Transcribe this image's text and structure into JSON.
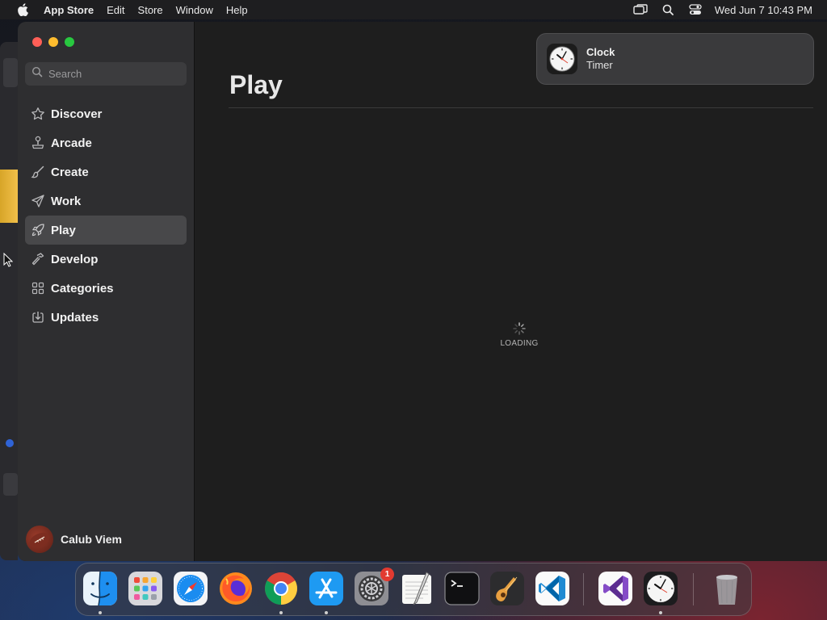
{
  "menubar": {
    "apple_icon": "apple-logo-icon",
    "app_name": "App Store",
    "menus": [
      "Edit",
      "Store",
      "Window",
      "Help"
    ],
    "status_icons": [
      "screen-mirroring-icon",
      "spotlight-search-icon",
      "control-center-icon"
    ],
    "datetime": "Wed Jun 7  10:43 PM"
  },
  "window": {
    "search": {
      "placeholder": "Search",
      "value": ""
    },
    "sidebar": {
      "items": [
        {
          "label": "Discover",
          "icon": "star-icon",
          "selected": false
        },
        {
          "label": "Arcade",
          "icon": "joystick-icon",
          "selected": false
        },
        {
          "label": "Create",
          "icon": "paintbrush-icon",
          "selected": false
        },
        {
          "label": "Work",
          "icon": "paperplane-icon",
          "selected": false
        },
        {
          "label": "Play",
          "icon": "rocket-icon",
          "selected": true
        },
        {
          "label": "Develop",
          "icon": "hammer-icon",
          "selected": false
        },
        {
          "label": "Categories",
          "icon": "grid-icon",
          "selected": false
        },
        {
          "label": "Updates",
          "icon": "download-icon",
          "selected": false
        }
      ],
      "user_name": "Calub Viem"
    },
    "page_title": "Play",
    "loading_label": "LOADING"
  },
  "notification": {
    "title": "Clock",
    "body": "Timer",
    "icon": "clock-icon"
  },
  "dock": {
    "apps": [
      {
        "name": "Finder",
        "icon": "finder-icon",
        "running": true
      },
      {
        "name": "Launchpad",
        "icon": "launchpad-icon",
        "running": false
      },
      {
        "name": "Safari",
        "icon": "safari-icon",
        "running": false
      },
      {
        "name": "Firefox",
        "icon": "firefox-icon",
        "running": false
      },
      {
        "name": "Chrome",
        "icon": "chrome-icon",
        "running": true
      },
      {
        "name": "App Store",
        "icon": "app-store-icon",
        "running": true
      },
      {
        "name": "System Settings",
        "icon": "system-settings-icon",
        "running": false,
        "badge": "1"
      },
      {
        "name": "TextEdit",
        "icon": "textedit-icon",
        "running": false
      },
      {
        "name": "Terminal",
        "icon": "terminal-icon",
        "running": false
      },
      {
        "name": "GarageBand",
        "icon": "garageband-icon",
        "running": false
      },
      {
        "name": "Visual Studio Code",
        "icon": "vscode-icon",
        "running": false
      },
      {
        "name": "Visual Studio",
        "icon": "visual-studio-icon",
        "running": false
      },
      {
        "name": "Clock",
        "icon": "clock-app-icon",
        "running": true
      },
      {
        "name": "Trash",
        "icon": "trash-icon",
        "running": false
      }
    ]
  },
  "colors": {
    "close": "#ff5f57",
    "minimize": "#febc2e",
    "zoom": "#28c840",
    "selected_row": "#48484a",
    "badge": "#e23a30"
  }
}
